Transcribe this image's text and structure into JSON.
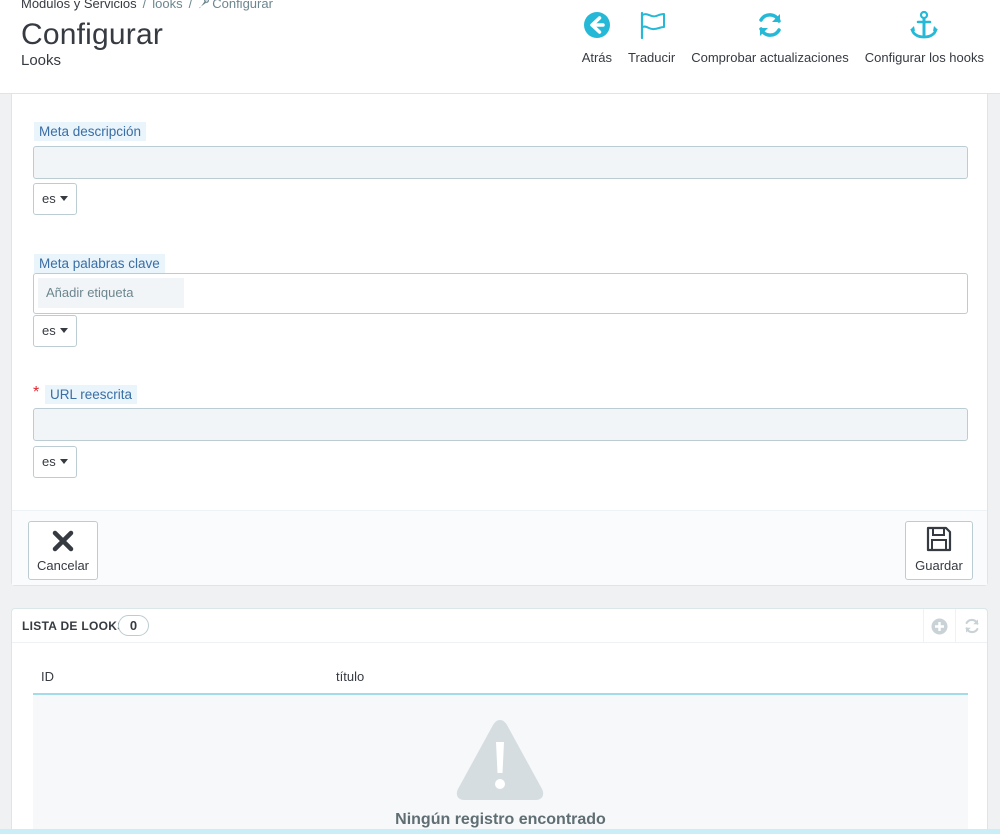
{
  "breadcrumb": {
    "item1": "Módulos y Servicios",
    "item2": "looks",
    "item3": "Configurar"
  },
  "header": {
    "title": "Configurar",
    "subtitle": "Looks"
  },
  "toolbar": {
    "back_label": "Atrás",
    "translate_label": "Traducir",
    "check_updates_label": "Comprobar actualizaciones",
    "hooks_label": "Configurar los hooks"
  },
  "form": {
    "meta_description": {
      "label": "Meta descripción",
      "value": "",
      "lang": "es"
    },
    "meta_keywords": {
      "label": "Meta palabras clave",
      "placeholder": "Añadir etiqueta",
      "lang": "es"
    },
    "url_rewrite": {
      "label": "URL reescrita",
      "required_mark": "*",
      "value": "",
      "lang": "es"
    },
    "cancel_label": "Cancelar",
    "save_label": "Guardar"
  },
  "list": {
    "title": "LISTA DE LOOKS",
    "count": "0",
    "columns": [
      "ID",
      "título"
    ],
    "empty_message": "Ningún registro encontrado"
  },
  "colors": {
    "accent": "#25b9d7",
    "label_bg": "#e9f4fb",
    "required": "#e0262c"
  }
}
